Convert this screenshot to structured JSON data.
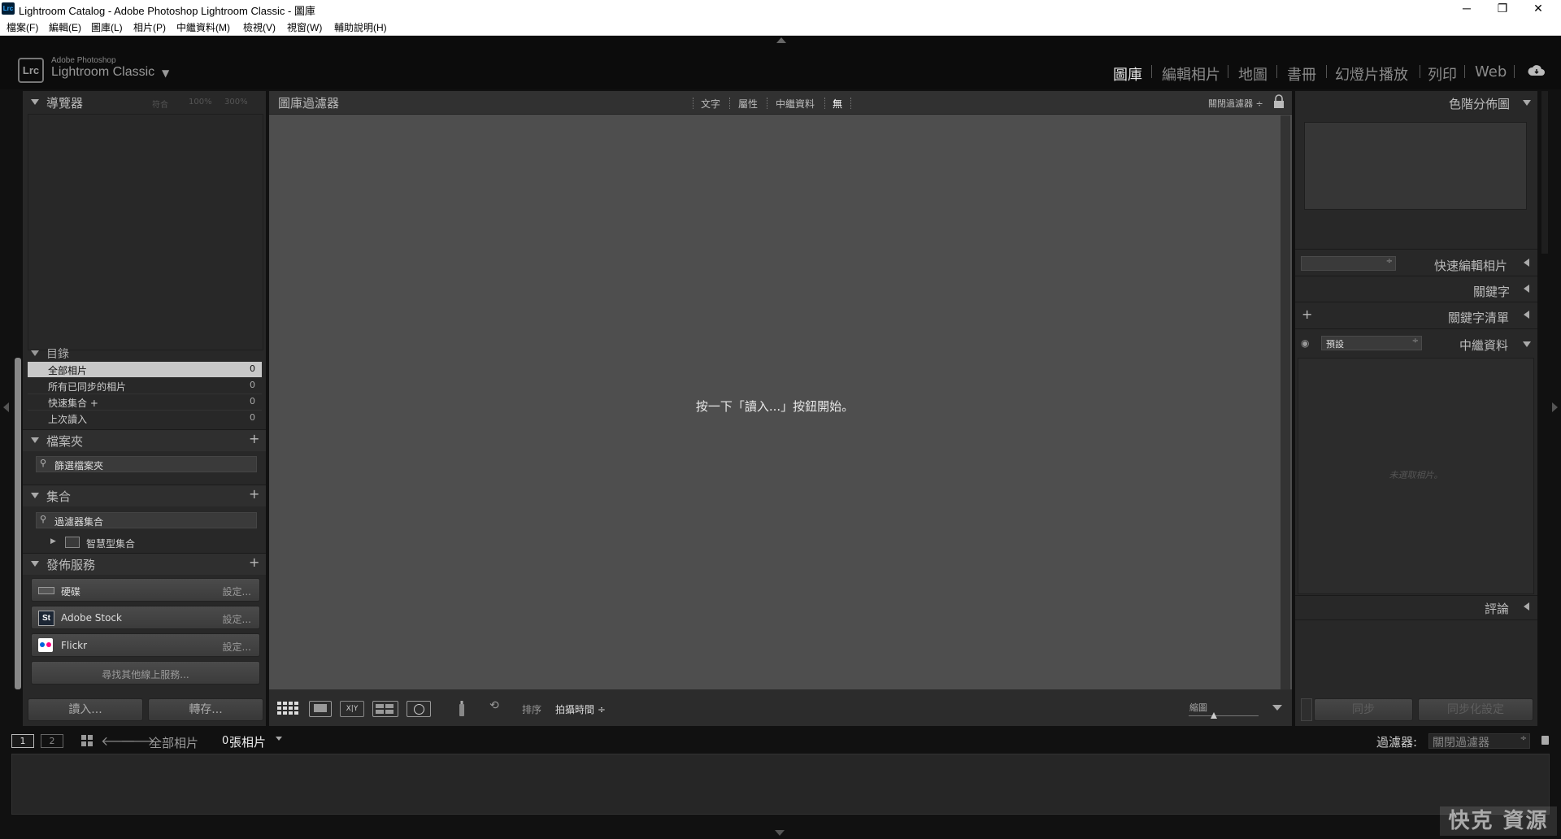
{
  "window": {
    "title": "Lightroom Catalog - Adobe Photoshop Lightroom Classic - 圖庫",
    "app_icon": "Lrc",
    "controls": {
      "minimize": "─",
      "maximize": "❐",
      "close": "✕"
    }
  },
  "menu": [
    "檔案(F)",
    "編輯(E)",
    "圖庫(L)",
    "相片(P)",
    "中繼資料(M)",
    "檢視(V)",
    "視窗(W)",
    "輔助說明(H)"
  ],
  "identity": {
    "logo": "Lrc",
    "line1": "Adobe Photoshop",
    "line2": "Lightroom Classic"
  },
  "modules": [
    "圖庫",
    "編輯相片",
    "地圖",
    "書冊",
    "幻燈片播放",
    "列印",
    "Web"
  ],
  "active_module": "圖庫",
  "left_panel": {
    "navigator": {
      "title": "導覽器",
      "zoom_options": [
        "符合",
        "100%",
        "300%"
      ]
    },
    "catalog": {
      "title": "目錄",
      "items": [
        {
          "label": "全部相片",
          "count": "0"
        },
        {
          "label": "所有已同步的相片",
          "count": "0"
        },
        {
          "label": "快速集合 +",
          "count": "0"
        },
        {
          "label": "上次讀入",
          "count": "0"
        }
      ]
    },
    "folders": {
      "title": "檔案夾",
      "filter_placeholder": "篩選檔案夾"
    },
    "collections": {
      "title": "集合",
      "filter_placeholder": "過濾器集合",
      "smart_collection": "智慧型集合"
    },
    "publish": {
      "title": "發佈服務",
      "services": [
        {
          "name": "硬碟",
          "settings": "設定..."
        },
        {
          "name": "Adobe Stock",
          "settings": "設定..."
        },
        {
          "name": "Flickr",
          "settings": "設定..."
        }
      ],
      "find_more": "尋找其他線上服務..."
    },
    "import_button": "讀入...",
    "export_button": "轉存..."
  },
  "filter_bar": {
    "title": "圖庫過濾器",
    "tabs": [
      "文字",
      "屬性",
      "中繼資料",
      "無"
    ],
    "active_tab": "無",
    "filter_off": "關閉過濾器 ÷"
  },
  "center_message": "按一下「讀入...」按鈕開始。",
  "toolbar": {
    "sort_label": "排序",
    "sort_value": "拍攝時間 ÷",
    "thumbnail_label": "縮圖"
  },
  "right_panel": {
    "histogram": "色階分佈圖",
    "quick_develop": "快速編輯相片",
    "keywording": "關鍵字",
    "keyword_list": "關鍵字清單",
    "metadata": "中繼資料",
    "metadata_preset": "預設",
    "no_selection": "未選取相片。",
    "comments": "評論",
    "sync_button": "同步",
    "sync_settings_button": "同步化設定"
  },
  "filmstrip_bar": {
    "screen1": "1",
    "screen2": "2",
    "source": "全部相片",
    "photo_count": "0",
    "photo_count_suffix": "張相片",
    "filter_label": "過濾器:",
    "filter_value": "關閉過濾器"
  },
  "watermark": "快克 資源"
}
